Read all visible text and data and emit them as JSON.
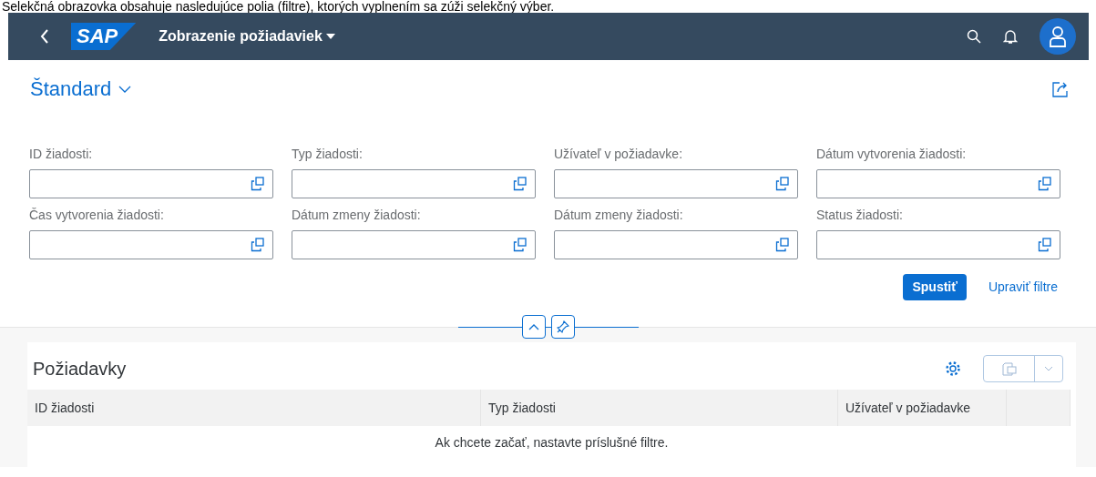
{
  "caption": "Selekčná obrazovka obsahuje nasledujúce polia (filtre), ktorých vyplnením sa zúži selekčný výber.",
  "shell": {
    "title": "Zobrazenie požiadaviek",
    "logo": "SAP"
  },
  "variant": {
    "name": "Štandard"
  },
  "filters": [
    {
      "label": "ID žiadosti:"
    },
    {
      "label": "Typ žiadosti:"
    },
    {
      "label": "Užívateľ v požiadavke:"
    },
    {
      "label": "Dátum vytvorenia žiadosti:"
    },
    {
      "label": "Čas vytvorenia žiadosti:"
    },
    {
      "label": "Dátum zmeny žiadosti:"
    },
    {
      "label": "Dátum zmeny žiadosti:"
    },
    {
      "label": "Status žiadosti:"
    }
  ],
  "actions": {
    "go": "Spustiť",
    "adapt": "Upraviť filtre"
  },
  "table": {
    "title": "Požiadavky",
    "columns": [
      "ID žiadosti",
      "Typ žiadosti",
      "Užívateľ v požiadavke"
    ],
    "no_data": "Ak chcete začať, nastavte príslušné filtre."
  }
}
